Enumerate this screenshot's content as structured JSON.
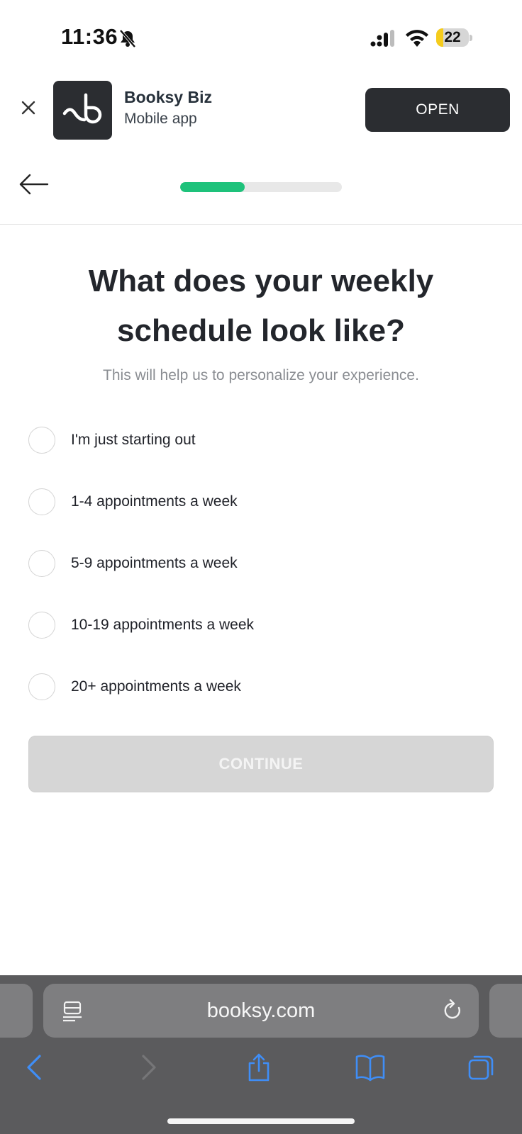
{
  "status_bar": {
    "time": "11:36",
    "battery_level": "22",
    "battery_fraction": 0.22,
    "icons": [
      "bell-slash-icon",
      "cellular-signal-icon",
      "wifi-icon",
      "battery-icon"
    ]
  },
  "app_banner": {
    "name": "Booksy Biz",
    "subtitle": "Mobile app",
    "open_label": "OPEN",
    "icons": [
      "close-icon",
      "booksy-logo-icon"
    ]
  },
  "header": {
    "progress_fraction": 0.4,
    "progress_color": "#1ec27b",
    "icons": [
      "back-arrow-icon"
    ]
  },
  "main": {
    "title": "What does your weekly schedule look like?",
    "subtitle": "This will help us to personalize your experience.",
    "options": [
      {
        "label": "I'm just starting out",
        "selected": false
      },
      {
        "label": "1-4 appointments a week",
        "selected": false
      },
      {
        "label": "5-9 appointments a week",
        "selected": false
      },
      {
        "label": "10-19 appointments a week",
        "selected": false
      },
      {
        "label": "20+ appointments a week",
        "selected": false
      }
    ],
    "continue_label": "CONTINUE",
    "continue_enabled": false
  },
  "browser": {
    "url": "booksy.com",
    "accent_color": "#3f8ef7",
    "icons": [
      "reader-icon",
      "reload-icon",
      "back-chevron-icon",
      "forward-chevron-icon",
      "share-icon",
      "bookmarks-icon",
      "tabs-icon"
    ]
  }
}
